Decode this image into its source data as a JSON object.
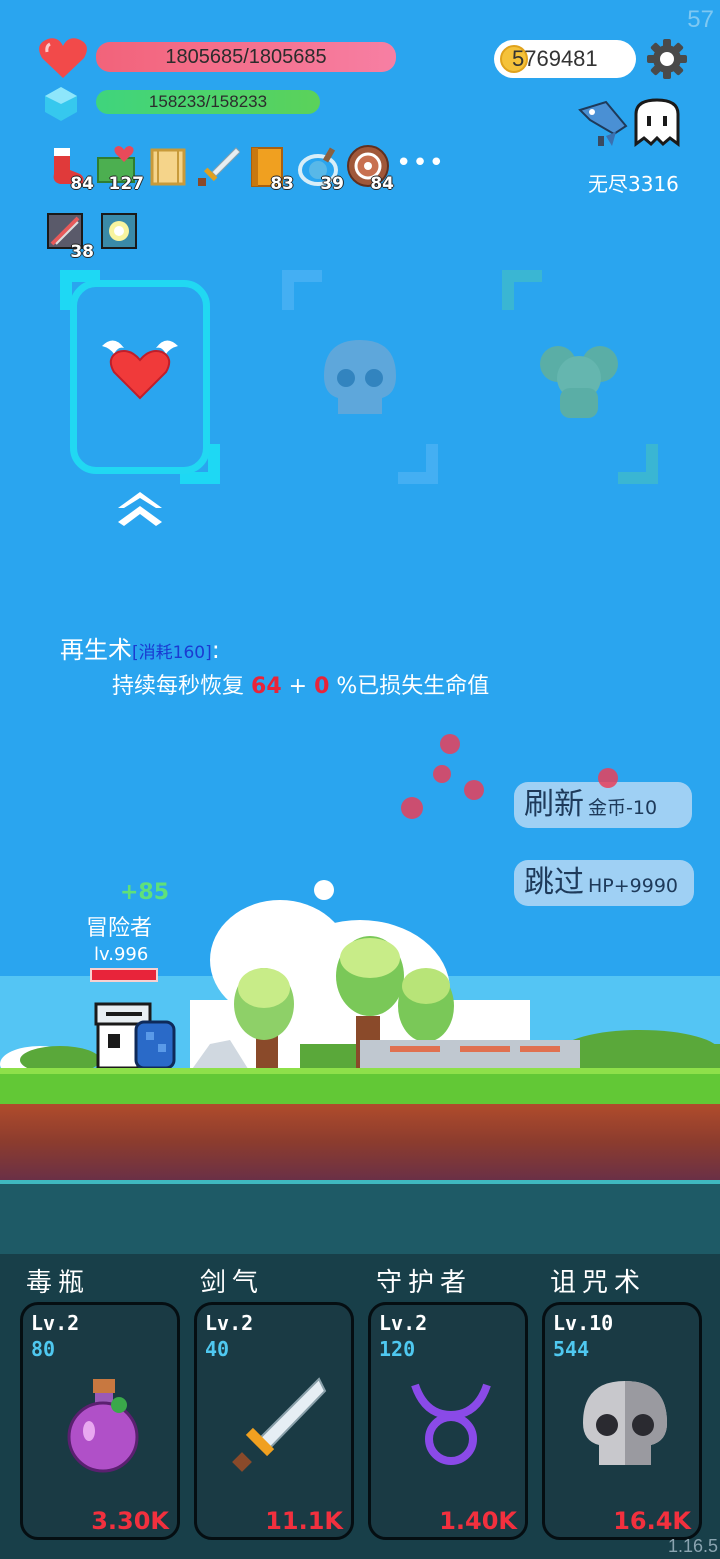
{
  "fps": "57",
  "hp": "1805685/1805685",
  "mp": "158233/158233",
  "gold": "5769481",
  "endless": "无尽3316",
  "items": [
    {
      "icon": "sock-icon",
      "count": "84"
    },
    {
      "icon": "heart-cash-icon",
      "count": "127"
    },
    {
      "icon": "scroll-icon",
      "count": ""
    },
    {
      "icon": "sword-icon",
      "count": ""
    },
    {
      "icon": "book-icon",
      "count": "83"
    },
    {
      "icon": "potion-ring-icon",
      "count": "39"
    },
    {
      "icon": "shield-icon",
      "count": "84"
    }
  ],
  "items_more": "•••",
  "items2": [
    {
      "icon": "blade-box-icon",
      "count": "38"
    },
    {
      "icon": "glow-gem-icon",
      "count": ""
    }
  ],
  "skill": {
    "name": "再生术",
    "cost": "[消耗160]",
    "colon": ":",
    "desc_prefix": "持续每秒恢复",
    "value1": "64",
    "plus": "+",
    "value2": "0",
    "desc_suffix": "%已损失生命值"
  },
  "refresh": {
    "label": "刷新",
    "sub": "金币-10"
  },
  "skip": {
    "label": "跳过",
    "sub": "HP+9990"
  },
  "hero": {
    "heal": "+85",
    "name": "冒险者",
    "level": "lv.996"
  },
  "cards": [
    {
      "name": "毒瓶",
      "lv": "Lv.2",
      "cost": "80",
      "price": "3.30K"
    },
    {
      "name": "剑气",
      "lv": "Lv.2",
      "cost": "40",
      "price": "11.1K"
    },
    {
      "name": "守护者",
      "lv": "Lv.2",
      "cost": "120",
      "price": "1.40K"
    },
    {
      "name": "诅咒术",
      "lv": "Lv.10",
      "cost": "544",
      "price": "16.4K"
    }
  ],
  "version": "1.16.5"
}
